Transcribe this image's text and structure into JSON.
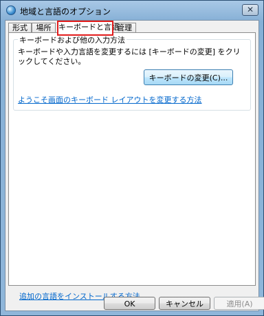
{
  "window": {
    "title": "地域と言語のオプション",
    "close_glyph": "✕",
    "icon": "globe-icon"
  },
  "tabs": [
    {
      "label": "形式"
    },
    {
      "label": "場所"
    },
    {
      "label": "キーボードと言語",
      "selected": true
    },
    {
      "label": "管理"
    }
  ],
  "highlight_color": "#e21b1b",
  "keyboard_group": {
    "title": "キーボードおよび他の入力方法",
    "description": "キーボードや入力言語を変更するには [キーボードの変更] をクリックしてください。",
    "change_button": "キーボードの変更(C)...",
    "layout_link": "ようこそ画面のキーボード レイアウトを変更する方法"
  },
  "install_link": "追加の言語をインストールする方法",
  "footer": {
    "ok": "OK",
    "cancel": "キャンセル",
    "apply": "適用(A)"
  }
}
